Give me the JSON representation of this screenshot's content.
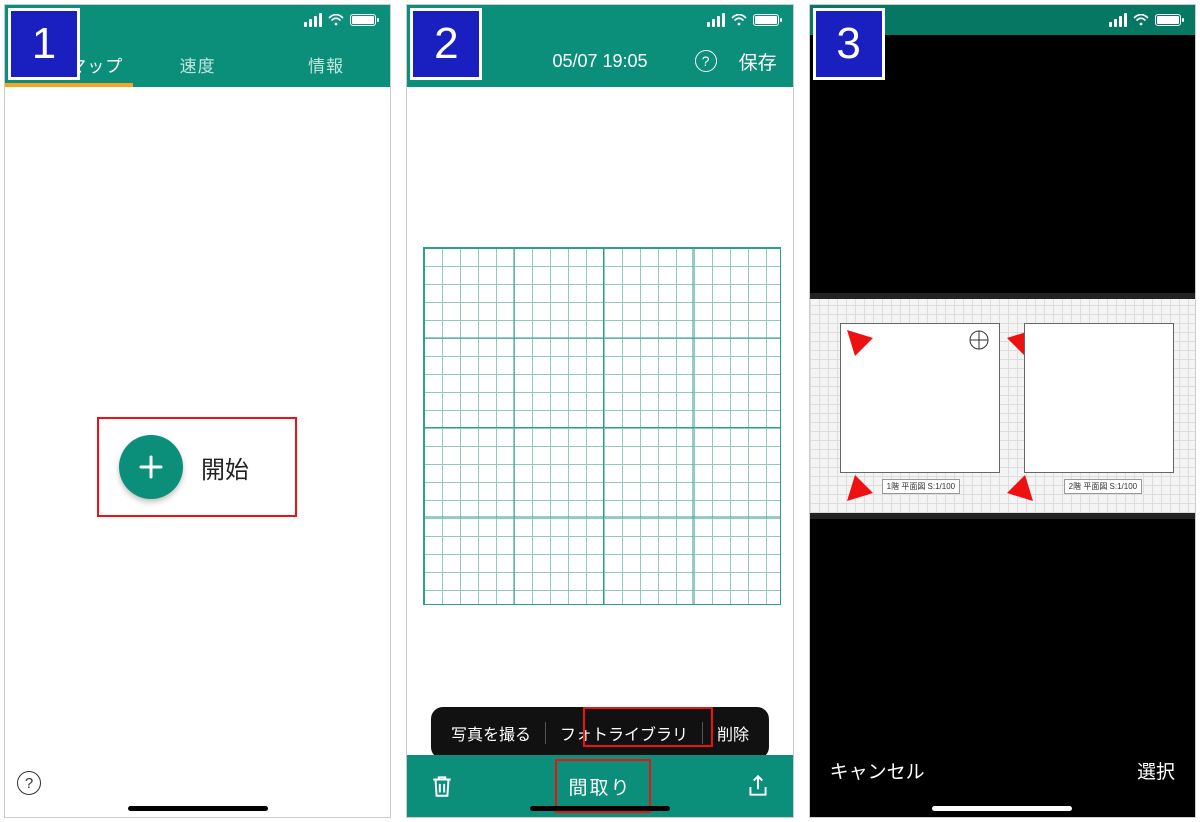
{
  "steps": {
    "s1": "1",
    "s2": "2",
    "s3": "3"
  },
  "colors": {
    "teal": "#0b8f7a",
    "badge": "#1a1fbf",
    "accent": "#f4a521",
    "highlight": "#e11"
  },
  "screen1": {
    "tabs": {
      "heatmap": "ヒートマップ",
      "speed": "速度",
      "info": "情報"
    },
    "start_label": "開始",
    "help_glyph": "?"
  },
  "screen2": {
    "timestamp": "05/07 19:05",
    "help_glyph": "?",
    "save_label": "保存",
    "popup": {
      "take_photo": "写真を撮る",
      "photo_library": "フォトライブラリ",
      "delete": "削除"
    },
    "floorplan_button": "間取り"
  },
  "screen3": {
    "cancel": "キャンセル",
    "select": "選択",
    "floorplan_caption_left": "1階 平面図 S:1/100",
    "floorplan_caption_right": "2階 平面図 S:1/100"
  }
}
